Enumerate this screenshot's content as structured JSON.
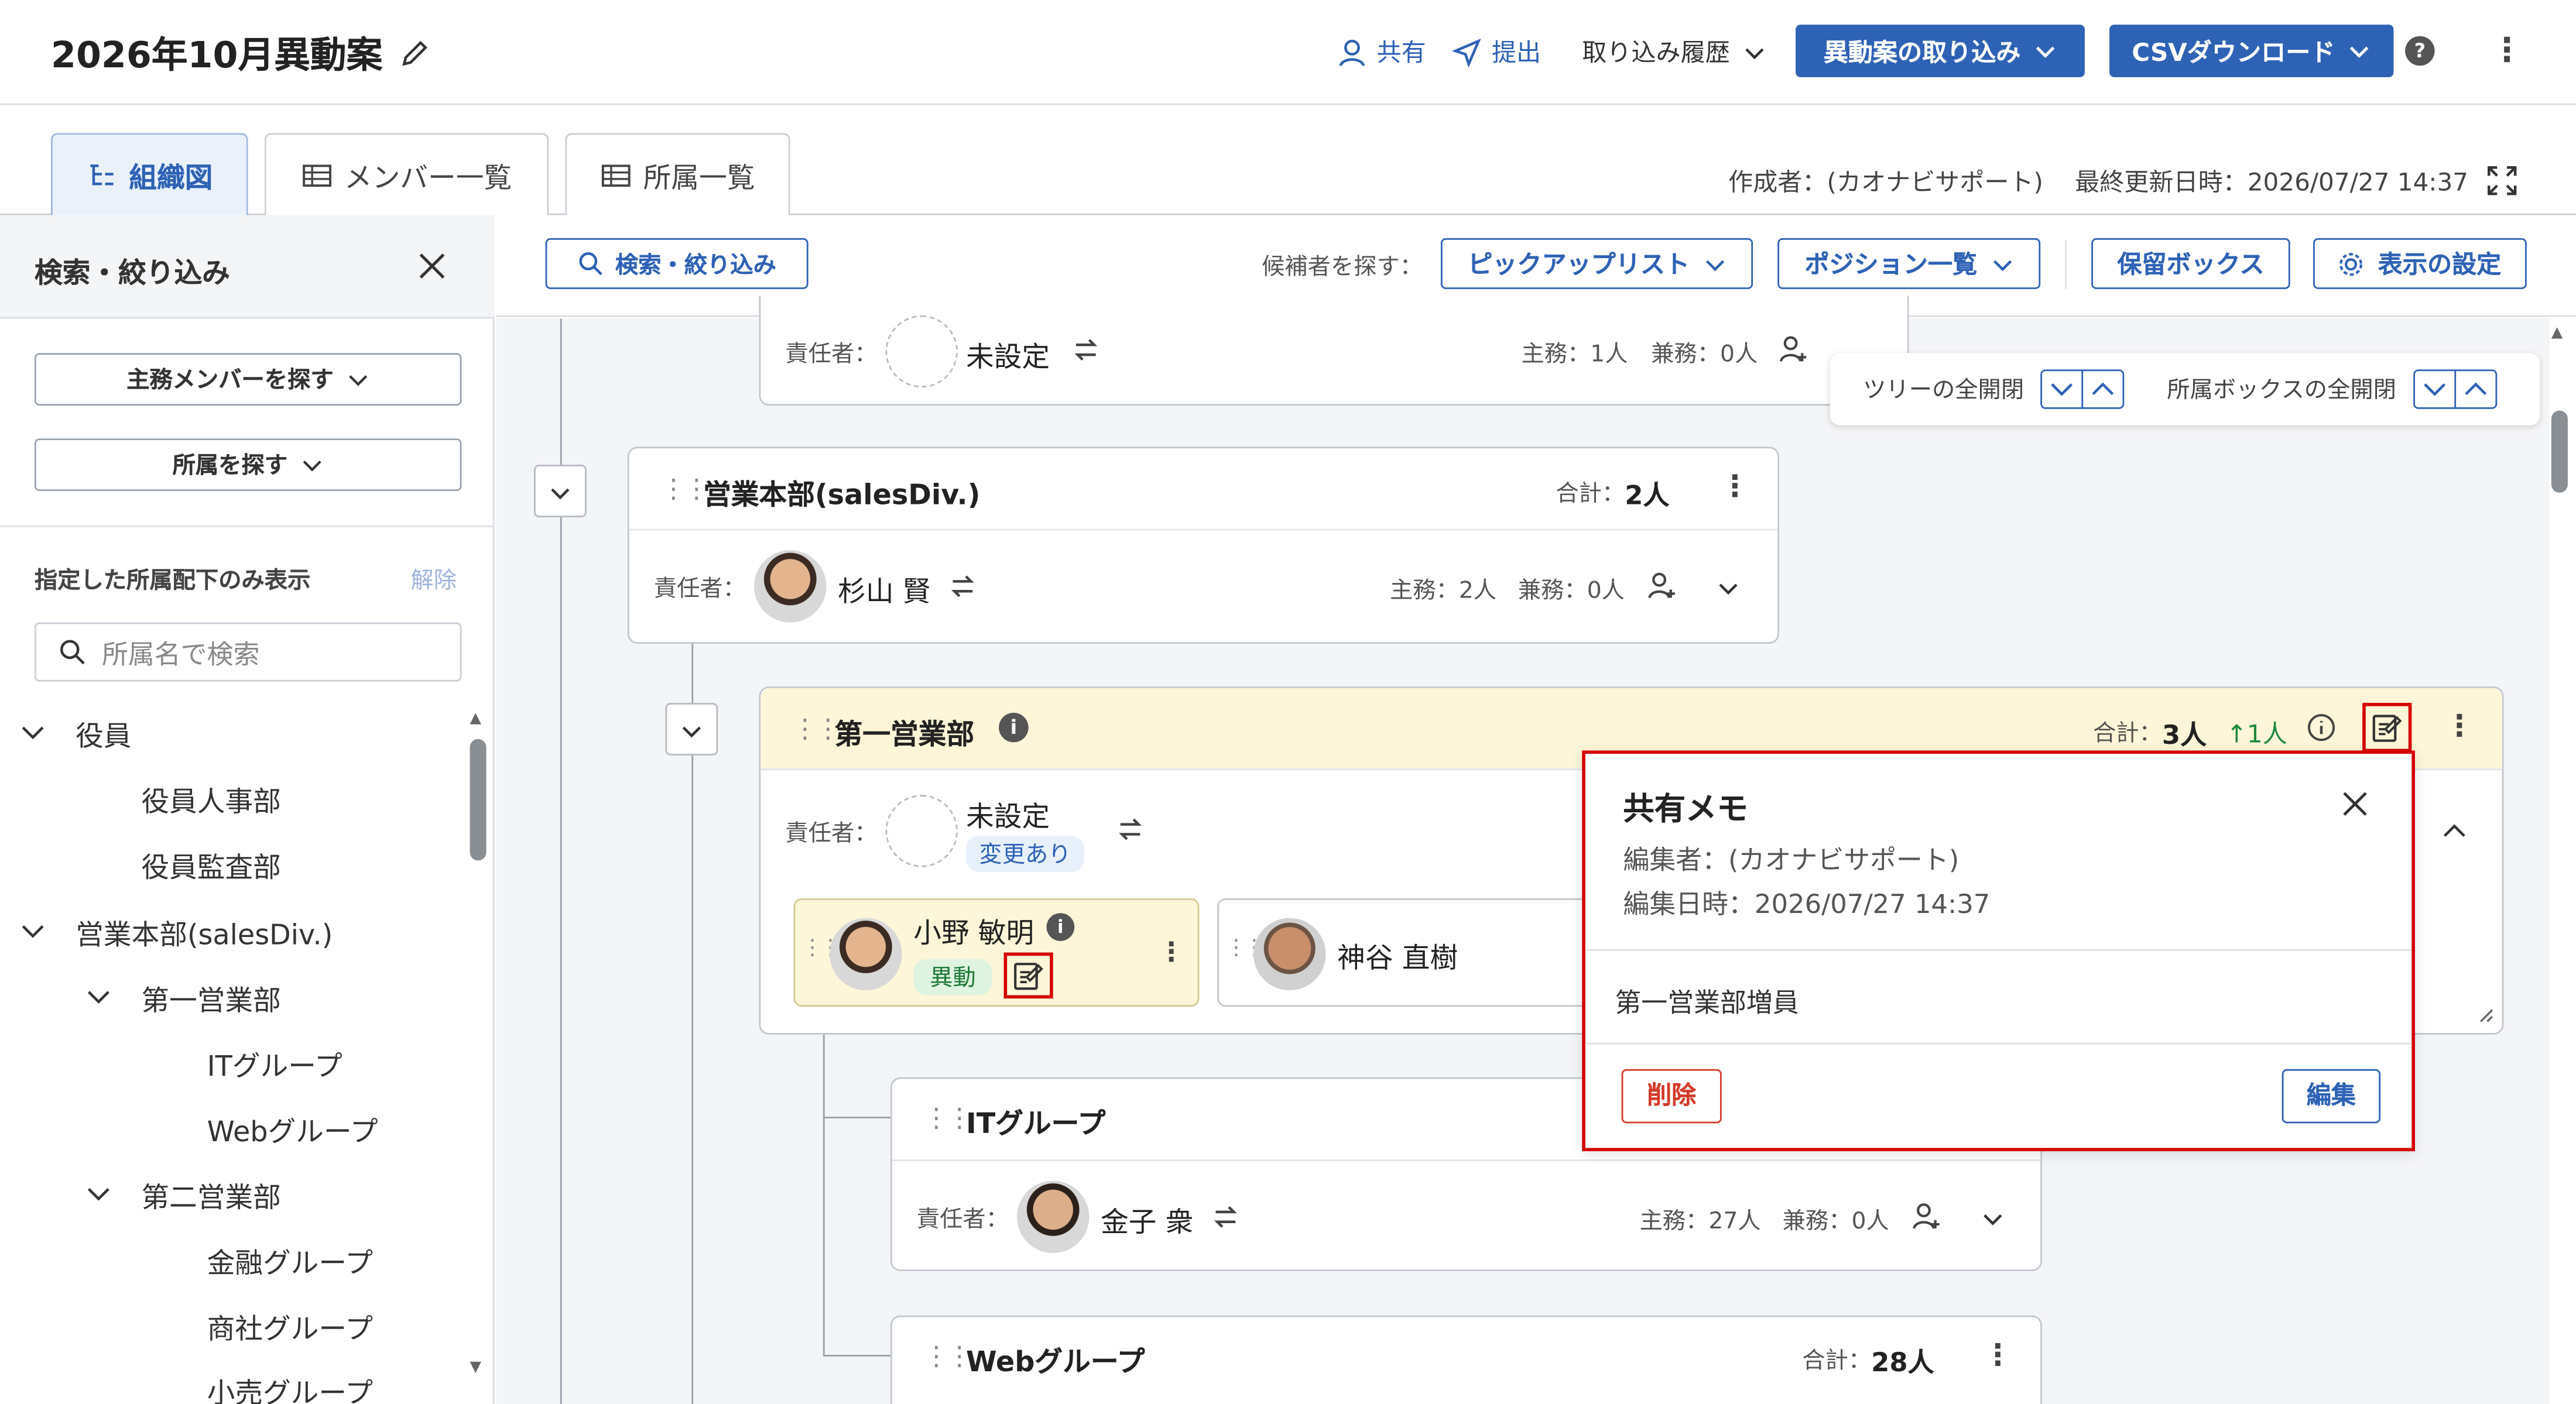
{
  "header": {
    "title": "2026年10月異動案",
    "share": "共有",
    "submit": "提出",
    "import_history": "取り込み履歴",
    "import_plan": "異動案の取り込み",
    "csv_download": "CSVダウンロード"
  },
  "tabs": [
    "組織図",
    "メンバー一覧",
    "所属一覧"
  ],
  "meta": {
    "creator": "作成者：(カオナビサポート)",
    "updated": "最終更新日時：2026/07/27 14:37"
  },
  "sidebar": {
    "title": "検索・絞り込み",
    "find_member": "主務メンバーを探す",
    "find_dept": "所属を探す",
    "filter_label": "指定した所属配下のみ表示",
    "clear": "解除",
    "search_placeholder": "所属名で検索",
    "tree": [
      {
        "label": "役員",
        "level": 0,
        "expanded": true
      },
      {
        "label": "役員人事部",
        "level": 1
      },
      {
        "label": "役員監査部",
        "level": 1
      },
      {
        "label": "営業本部(salesDiv.)",
        "level": 0,
        "expanded": true
      },
      {
        "label": "第一営業部",
        "level": 1,
        "expanded": true
      },
      {
        "label": "ITグループ",
        "level": 2
      },
      {
        "label": "Webグループ",
        "level": 2
      },
      {
        "label": "第二営業部",
        "level": 1,
        "expanded": true
      },
      {
        "label": "金融グループ",
        "level": 2
      },
      {
        "label": "商社グループ",
        "level": 2
      },
      {
        "label": "小売グループ",
        "level": 2
      }
    ]
  },
  "toolbar": {
    "search_filter": "検索・絞り込み",
    "find_candidates": "候補者を探す：",
    "pickup_list": "ピックアップリスト",
    "position_list": "ポジション一覧",
    "hold_box": "保留ボックス",
    "display_settings": "表示の設定"
  },
  "expand_panel": {
    "tree_expand": "ツリーの全開閉",
    "box_expand": "所属ボックスの全開閉"
  },
  "top_partial_card": {
    "manager_label": "責任者：",
    "manager_name": "未設定",
    "main_count": "主務：1人",
    "concurrent_count": "兼務：0人"
  },
  "sales_div": {
    "name": "営業本部(salesDiv.)",
    "total_label": "合計：",
    "total": "2人",
    "manager_label": "責任者：",
    "manager_name": "杉山 賢",
    "main_count": "主務：2人",
    "concurrent_count": "兼務：0人"
  },
  "sales1": {
    "name": "第一営業部",
    "total_label": "合計：",
    "total": "3人",
    "delta": "↑1人",
    "manager_label": "責任者：",
    "manager_name": "未設定",
    "changed_badge": "変更あり",
    "members": [
      {
        "name": "小野 敏明",
        "badge": "異動"
      },
      {
        "name": "神谷 直樹"
      }
    ]
  },
  "memo_popup": {
    "title": "共有メモ",
    "editor": "編集者：(カオナビサポート)",
    "edited_at": "編集日時：2026/07/27 14:37",
    "body": "第一営業部増員",
    "delete": "削除",
    "edit": "編集"
  },
  "it_group": {
    "name": "ITグループ",
    "manager_label": "責任者：",
    "manager_name": "金子 衆",
    "main_count": "主務：27人",
    "concurrent_count": "兼務：0人"
  },
  "web_group": {
    "name": "Webグループ",
    "total_label": "合計：",
    "total": "28人"
  },
  "colors": {
    "primary": "#2e62b5",
    "highlight": "#fdf6d8",
    "annotation": "#d40000",
    "transfer_badge": "#dff3e1",
    "changed_badge": "#e7f0fb"
  }
}
